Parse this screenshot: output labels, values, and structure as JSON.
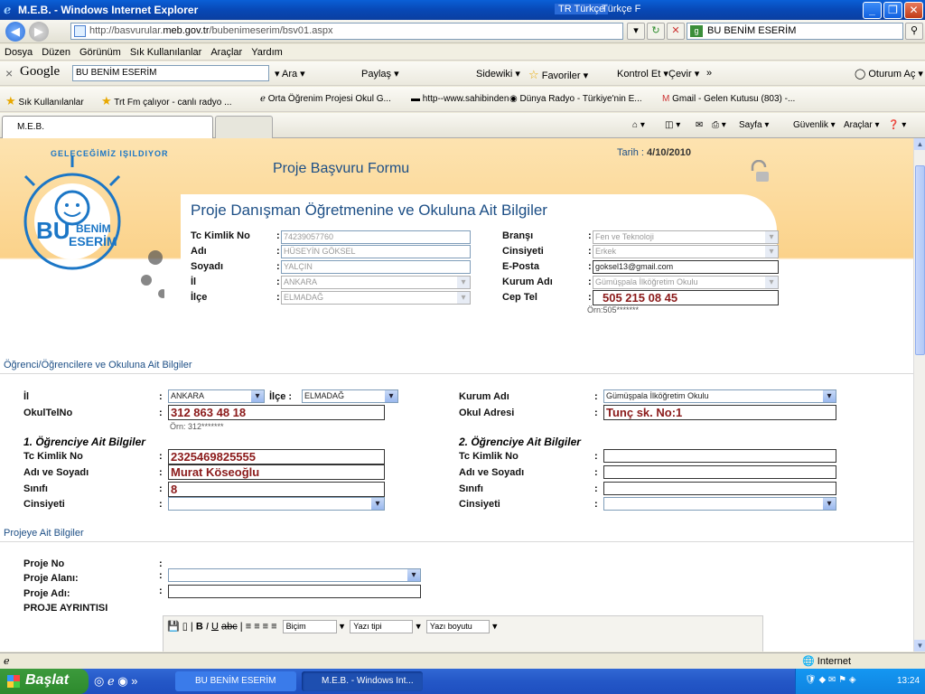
{
  "window": {
    "title": "M.E.B. - Windows Internet Explorer",
    "lang": "TR Türkçe",
    "lang2": "Türkçe F"
  },
  "browser": {
    "url_prefix": "http://basvurular.",
    "url_domain": "meb.gov.tr",
    "url_suffix": "/bubenimeserim/bsv01.aspx",
    "search_text": "BU BENİM ESERİM",
    "menu": [
      "Dosya",
      "Düzen",
      "Görünüm",
      "Sık Kullanılanlar",
      "Araçlar",
      "Yardım"
    ],
    "google": {
      "logo": "Google",
      "query": "BU BENİM ESERİM",
      "items": [
        "Ara",
        "Paylaş",
        "Sidewiki",
        "Favoriler",
        "Kontrol Et",
        "Çevir",
        "»",
        "Oturum Aç"
      ]
    },
    "favorites": [
      "Sık Kullanılanlar",
      "Trt Fm çalıyor - canlı radyo ...",
      "Orta Öğrenim Projesi Okul G...",
      "http--www.sahibinden",
      "Dünya Radyo - Türkiye'nin E...",
      "Gmail - Gelen Kutusu (803) -..."
    ],
    "tab": "M.E.B.",
    "tab_tools": [
      "Sayfa",
      "Güvenlik",
      "Araçlar"
    ],
    "status": "Internet"
  },
  "page": {
    "form_title": "Proje Başvuru Formu",
    "date_label": "Tarih :",
    "date_value": "4/10/2010",
    "logo_top": "GELECEĞİMİZ IŞILDIYOR",
    "logo_bu": "BU",
    "logo_benim": "BENİM",
    "logo_eserim": "ESERİM",
    "teacher_section": "Proje Danışman Öğretmenine ve Okuluna Ait Bilgiler",
    "teacher": {
      "tc_label": "Tc Kimlik No",
      "tc": "74239057760",
      "ad_label": "Adı",
      "ad": "HÜSEYİN GÖKSEL",
      "soyad_label": "Soyadı",
      "soyad": "YALÇIN",
      "il_label": "İl",
      "il": "ANKARA",
      "ilce_label": "İlçe",
      "ilce": "ELMADAĞ",
      "brans_label": "Branşı",
      "brans": "Fen ve Teknoloji",
      "cins_label": "Cinsiyeti",
      "cins": "Erkek",
      "eposta_label": "E-Posta",
      "eposta": "goksel13@gmail.com",
      "kurum_label": "Kurum Adı",
      "kurum": "Gümüşpala İlköğretim Okulu",
      "cep_label": "Cep Tel",
      "cep": "505 215 08 45",
      "cep_hint": "Örn:505*******"
    },
    "student_section": "Öğrenci/Öğrencilere ve Okuluna Ait Bilgiler",
    "school": {
      "il_label": "İl",
      "il": "ANKARA",
      "ilce_label": "İlçe :",
      "ilce": "ELMADAĞ",
      "kurum_label": "Kurum Adı",
      "kurum": "Gümüşpala İlköğretim Okulu",
      "tel_label": "OkulTelNo",
      "tel": "312 863 48 18",
      "tel_hint": "Örn: 312*******",
      "adres_label": "Okul Adresi",
      "adres": "Tunç sk. No:1"
    },
    "student1": {
      "heading": "1. Öğrenciye Ait Bilgiler",
      "tc_label": "Tc Kimlik No",
      "tc": "2325469825555",
      "ad_label": "Adı ve Soyadı",
      "ad": "Murat Köseoğlu",
      "sinif_label": "Sınıfı",
      "sinif": "8",
      "cins_label": "Cinsiyeti",
      "cins": ""
    },
    "student2": {
      "heading": "2. Öğrenciye Ait Bilgiler",
      "tc_label": "Tc Kimlik No",
      "tc": "",
      "ad_label": "Adı ve Soyadı",
      "ad": "",
      "sinif_label": "Sınıfı",
      "sinif": "",
      "cins_label": "Cinsiyeti",
      "cins": ""
    },
    "project_section": "Projeye Ait Bilgiler",
    "project": {
      "no_label": "Proje No",
      "alan_label": "Proje Alanı:",
      "ad_label": "Proje Adı:",
      "detay_label": "PROJE AYRINTISI"
    },
    "editor": {
      "bicim": "Biçim",
      "yazi_tipi": "Yazı tipi",
      "yazi_boyutu": "Yazı boyutu"
    }
  },
  "taskbar": {
    "start": "Başlat",
    "items": [
      "BU BENİM ESERİM",
      "M.E.B. - Windows Int..."
    ],
    "time": "13:24"
  }
}
